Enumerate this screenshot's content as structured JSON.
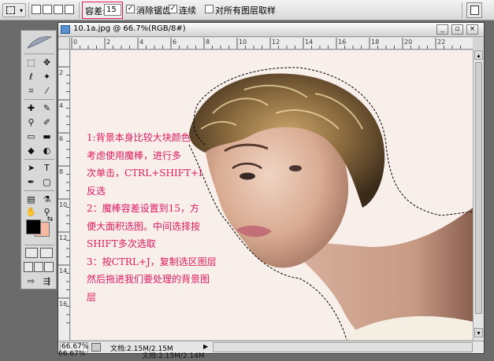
{
  "options_bar": {
    "tolerance_label": "容差:",
    "tolerance_value": "15",
    "anti_alias_label": "消除锯齿",
    "contiguous_label": "连续",
    "sample_all_layers_label": "对所有图层取样",
    "anti_alias_checked": true,
    "contiguous_checked": true,
    "sample_all_layers_checked": false,
    "icons": {
      "preset": "magic-wand-icon",
      "palette": "palette-well-icon"
    }
  },
  "document": {
    "title": "10.1a.jpg @ 66.7%(RGB/8#)",
    "zoom": "66.67%",
    "doc_size": "文档:2.15M/2.15M"
  },
  "background_status": {
    "zoom": "66.67%",
    "doc_size": "文档:2.15M/2.14M"
  },
  "rulers": {
    "h_labels": [
      "0",
      "2",
      "4",
      "6",
      "8",
      "10",
      "12",
      "14",
      "16",
      "18",
      "20",
      "22"
    ],
    "v_labels": [
      "2",
      "4",
      "6",
      "8",
      "10",
      "12",
      "14",
      "16"
    ]
  },
  "annotation": {
    "lines": [
      "1:背景本身比较大块颜色",
      "考虑使用魔棒，进行多",
      "次单击，CTRL+SHIFT+I",
      "反选",
      "2：魔棒容差设置到15，方",
      "便大面积选图。中间选择按",
      "SHIFT多次选取",
      "3：按CTRL+J，复制选区图层",
      "然后拖进我们要处理的背景图",
      "层"
    ],
    "color": "#e0195f"
  },
  "colors": {
    "foreground": "#000000",
    "background": "#f6b9a3"
  }
}
